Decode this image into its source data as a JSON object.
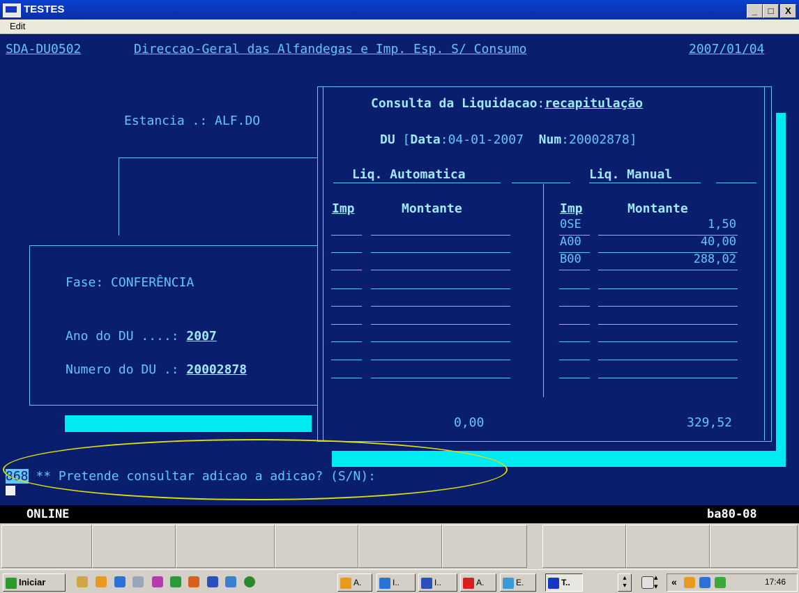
{
  "window": {
    "title": "TESTES",
    "min": "_",
    "max": "□",
    "close": "X"
  },
  "menu": {
    "edit": "Edit"
  },
  "header": {
    "code": "SDA-DU0502",
    "org": "Direccao-Geral das Alfandegas e Imp. Esp. S/ Consumo",
    "date": "2007/01/04"
  },
  "left": {
    "estancia_label": "Estancia .: ",
    "estancia_value": "ALF.DO",
    "fase_label": "Fase: ",
    "fase_value": "CONFERÊNCIA",
    "ano_label": "Ano do DU ....: ",
    "ano_value": "2007",
    "num_label": "Numero do DU .: ",
    "num_value": "20002878"
  },
  "panel": {
    "title_prefix": "Consulta da Liquidacao",
    "title_sep": ":",
    "title_value": "recapitulação",
    "du_label": "DU",
    "du_open": "[",
    "data_label": "Data",
    "data_value": "04-01-2007",
    "num_label": "Num",
    "num_value": "20002878]",
    "colon": ":",
    "auto_header": "Liq. Automatica",
    "manual_header": "Liq. Manual",
    "imp_header": "Imp",
    "montante_header": "Montante",
    "manual_rows": [
      {
        "imp": "0SE",
        "montante": "1,50"
      },
      {
        "imp": "A00",
        "montante": "40,00"
      },
      {
        "imp": "B00",
        "montante": "288,02"
      }
    ],
    "total_auto": "0,00",
    "total_manual": "329,52"
  },
  "prompt": {
    "code": "868",
    "text": " ** Pretende consultar adicao a adicao? (S/N):"
  },
  "status": {
    "left": "ONLINE",
    "right": "ba80-08"
  },
  "taskbar": {
    "start": "Iniciar",
    "tasks": [
      "A.",
      "I..",
      "I..",
      "A.",
      "E.",
      "T.."
    ],
    "clock": "17:46",
    "chevron": "«"
  }
}
